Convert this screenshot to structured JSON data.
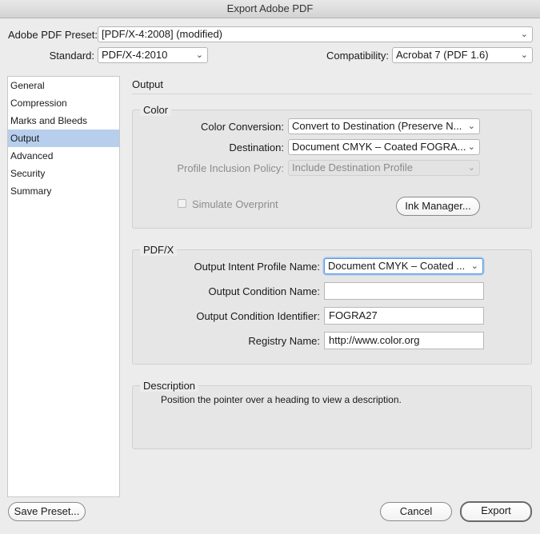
{
  "window": {
    "title": "Export Adobe PDF"
  },
  "top": {
    "preset_label": "Adobe PDF Preset:",
    "preset_value": "[PDF/X-4:2008] (modified)",
    "standard_label": "Standard:",
    "standard_value": "PDF/X-4:2010",
    "compat_label": "Compatibility:",
    "compat_value": "Acrobat 7 (PDF 1.6)"
  },
  "sidebar": {
    "items": [
      {
        "label": "General"
      },
      {
        "label": "Compression"
      },
      {
        "label": "Marks and Bleeds"
      },
      {
        "label": "Output"
      },
      {
        "label": "Advanced"
      },
      {
        "label": "Security"
      },
      {
        "label": "Summary"
      }
    ],
    "selected": "Output"
  },
  "section": {
    "title": "Output"
  },
  "color": {
    "title": "Color",
    "conversion_label": "Color Conversion:",
    "conversion_value": "Convert to Destination (Preserve N...",
    "destination_label": "Destination:",
    "destination_value": "Document CMYK – Coated FOGRA...",
    "profile_label": "Profile Inclusion Policy:",
    "profile_value": "Include Destination Profile",
    "simulate_label": "Simulate Overprint",
    "ink_button": "Ink Manager..."
  },
  "pdfx": {
    "title": "PDF/X",
    "intent_label": "Output Intent Profile Name:",
    "intent_value": "Document CMYK – Coated ...",
    "cond_name_label": "Output Condition Name:",
    "cond_name_value": "",
    "cond_id_label": "Output Condition Identifier:",
    "cond_id_value": "FOGRA27",
    "registry_label": "Registry Name:",
    "registry_value": "http://www.color.org"
  },
  "description": {
    "title": "Description",
    "text": "Position the pointer over a heading to view a description."
  },
  "buttons": {
    "save_preset": "Save Preset...",
    "cancel": "Cancel",
    "export": "Export"
  },
  "colors": {
    "selection": "#b7cfed",
    "focus": "#5e98e0"
  }
}
